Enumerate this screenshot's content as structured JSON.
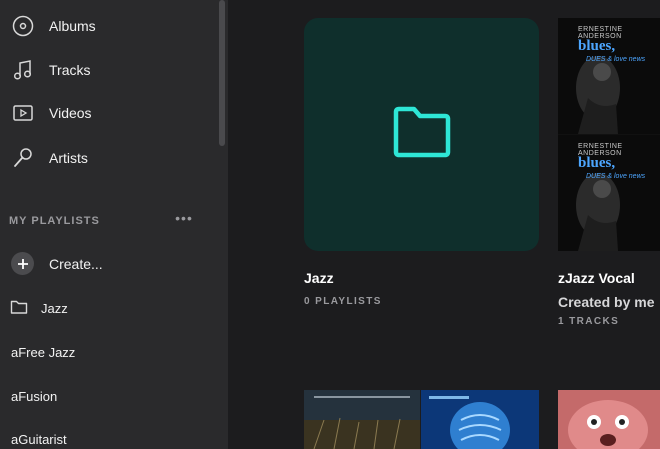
{
  "nav": {
    "albums": "Albums",
    "tracks": "Tracks",
    "videos": "Videos",
    "artists": "Artists"
  },
  "playlists": {
    "header": "MY PLAYLISTS",
    "more": "•••",
    "create": "Create...",
    "folder": "Jazz",
    "items": [
      "aFree Jazz",
      "aFusion",
      "aGuitarist"
    ]
  },
  "tiles": [
    {
      "title": "Jazz",
      "subtitle": "0 PLAYLISTS"
    },
    {
      "title": "zJazz Vocal",
      "subtitle": "Created by me",
      "count": "1 TRACKS"
    }
  ],
  "album_art": {
    "artist": "ERNESTINE ANDERSON",
    "title": "blues,",
    "sub": "DUES & love news"
  },
  "colors": {
    "sidebar_bg": "#2a2a2c",
    "main_bg": "#1c1c1e",
    "accent": "#2ee6d6",
    "folder_tile_bg": "#0f2f2c"
  }
}
